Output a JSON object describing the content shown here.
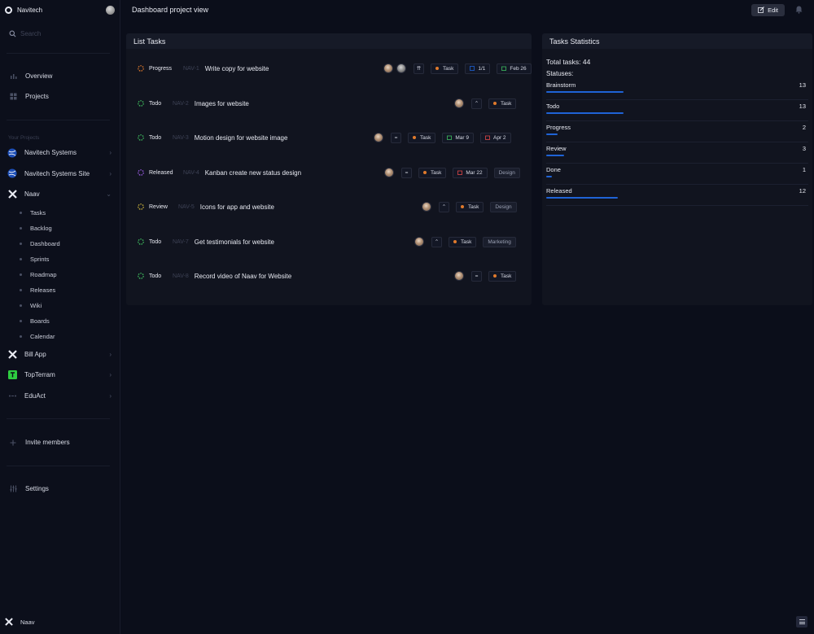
{
  "workspace": {
    "name": "Navitech"
  },
  "search": {
    "placeholder": "Search"
  },
  "nav": {
    "overview": "Overview",
    "projects": "Projects"
  },
  "projects_section": {
    "label": "Your Projects"
  },
  "projects": [
    {
      "name": "Navitech Systems",
      "icon": "globe-icon"
    },
    {
      "name": "Navitech Systems Site",
      "icon": "globe-icon"
    },
    {
      "name": "Naav",
      "icon": "naav-logo-icon"
    },
    {
      "name": "Bill App",
      "icon": "naav-logo-icon"
    },
    {
      "name": "TopTerram",
      "icon": "green-t-icon"
    },
    {
      "name": "EduAct",
      "icon": "dots-icon"
    }
  ],
  "naav_subitems": [
    "Tasks",
    "Backlog",
    "Dashboard",
    "Sprints",
    "Roadmap",
    "Releases",
    "Wiki",
    "Boards",
    "Calendar"
  ],
  "footer_links": {
    "invite": "Invite members",
    "settings": "Settings"
  },
  "sidebar_bottom": {
    "project": "Naav"
  },
  "header": {
    "title": "Dashboard project view",
    "edit_label": "Edit"
  },
  "list_tasks": {
    "title": "List Tasks",
    "tasks": [
      {
        "status": "Progress",
        "key": "NAV-1",
        "title": "Write copy for website",
        "type": "Task",
        "subtasks": "1/1",
        "date": "Feb 26",
        "label": ""
      },
      {
        "status": "Todo",
        "key": "NAV-2",
        "title": "Images for website",
        "type": "Task",
        "label": ""
      },
      {
        "status": "Todo",
        "key": "NAV-3",
        "title": "Motion design for website image",
        "type": "Task",
        "start": "Mar 9",
        "due": "Apr 2",
        "label": ""
      },
      {
        "status": "Released",
        "key": "NAV-4",
        "title": "Kanban create new status design",
        "type": "Task",
        "due": "Mar 22",
        "label": "Design"
      },
      {
        "status": "Review",
        "key": "NAV-5",
        "title": "Icons for app and website",
        "type": "Task",
        "label": "Design"
      },
      {
        "status": "Todo",
        "key": "NAV-7",
        "title": "Get testimonials for website",
        "type": "Task",
        "label": "Marketing"
      },
      {
        "status": "Todo",
        "key": "NAV-8",
        "title": "Record video of Naav for Website",
        "type": "Task",
        "label": ""
      }
    ]
  },
  "stats": {
    "title": "Tasks Statistics",
    "total_label": "Total tasks: 44",
    "statuses_label": "Statuses:",
    "items": [
      {
        "name": "Brainstorm",
        "count": "13",
        "fraction": 0.295
      },
      {
        "name": "Todo",
        "count": "13",
        "fraction": 0.295
      },
      {
        "name": "Progress",
        "count": "2",
        "fraction": 0.045
      },
      {
        "name": "Review",
        "count": "3",
        "fraction": 0.068
      },
      {
        "name": "Done",
        "count": "1",
        "fraction": 0.023
      },
      {
        "name": "Released",
        "count": "12",
        "fraction": 0.273
      }
    ]
  },
  "colors": {
    "accent": "#1f63d6",
    "progress": "#e07a2c",
    "todo": "#3fbf5f",
    "released": "#9b5de5",
    "review": "#c9b23a"
  }
}
